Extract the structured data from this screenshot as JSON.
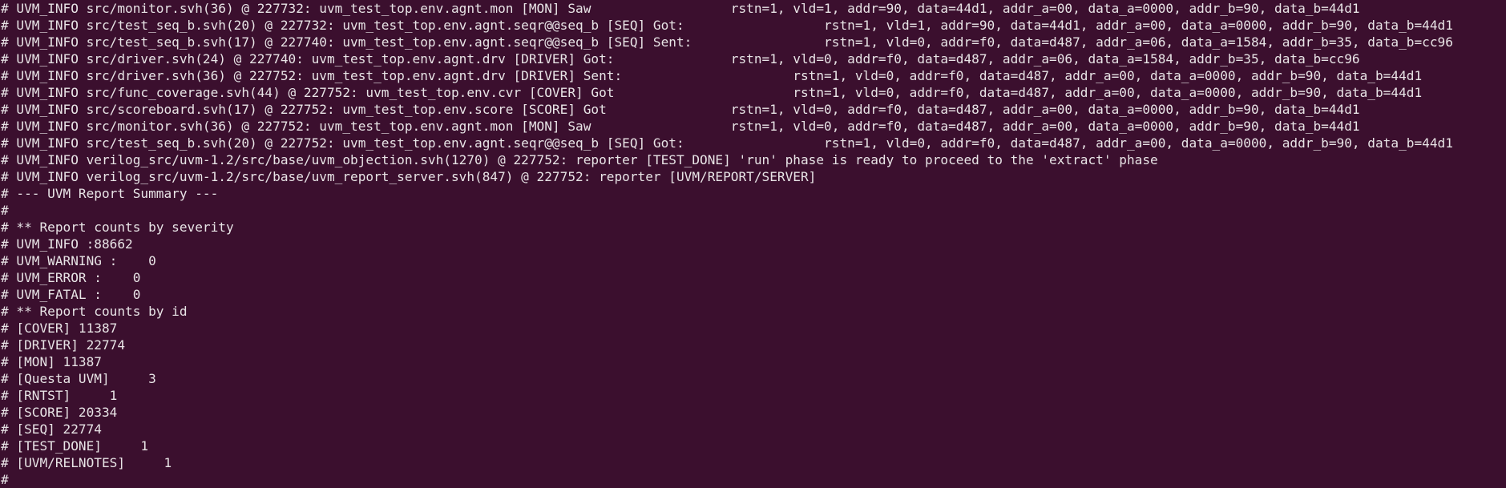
{
  "terminal": {
    "lines": [
      "# UVM_INFO src/monitor.svh(36) @ 227732: uvm_test_top.env.agnt.mon [MON] Saw                  rstn=1, vld=1, addr=90, data=44d1, addr_a=00, data_a=0000, addr_b=90, data_b=44d1",
      "# UVM_INFO src/test_seq_b.svh(20) @ 227732: uvm_test_top.env.agnt.seqr@@seq_b [SEQ] Got:                  rstn=1, vld=1, addr=90, data=44d1, addr_a=00, data_a=0000, addr_b=90, data_b=44d1",
      "# UVM_INFO src/test_seq_b.svh(17) @ 227740: uvm_test_top.env.agnt.seqr@@seq_b [SEQ] Sent:                 rstn=1, vld=0, addr=f0, data=d487, addr_a=06, data_a=1584, addr_b=35, data_b=cc96",
      "# UVM_INFO src/driver.svh(24) @ 227740: uvm_test_top.env.agnt.drv [DRIVER] Got:               rstn=1, vld=0, addr=f0, data=d487, addr_a=06, data_a=1584, addr_b=35, data_b=cc96",
      "# UVM_INFO src/driver.svh(36) @ 227752: uvm_test_top.env.agnt.drv [DRIVER] Sent:                      rstn=1, vld=0, addr=f0, data=d487, addr_a=00, data_a=0000, addr_b=90, data_b=44d1",
      "# UVM_INFO src/func_coverage.svh(44) @ 227752: uvm_test_top.env.cvr [COVER] Got                       rstn=1, vld=0, addr=f0, data=d487, addr_a=00, data_a=0000, addr_b=90, data_b=44d1",
      "# UVM_INFO src/scoreboard.svh(17) @ 227752: uvm_test_top.env.score [SCORE] Got                rstn=1, vld=0, addr=f0, data=d487, addr_a=00, data_a=0000, addr_b=90, data_b=44d1",
      "# UVM_INFO src/monitor.svh(36) @ 227752: uvm_test_top.env.agnt.mon [MON] Saw                  rstn=1, vld=0, addr=f0, data=d487, addr_a=00, data_a=0000, addr_b=90, data_b=44d1",
      "# UVM_INFO src/test_seq_b.svh(20) @ 227752: uvm_test_top.env.agnt.seqr@@seq_b [SEQ] Got:                  rstn=1, vld=0, addr=f0, data=d487, addr_a=00, data_a=0000, addr_b=90, data_b=44d1",
      "# UVM_INFO verilog_src/uvm-1.2/src/base/uvm_objection.svh(1270) @ 227752: reporter [TEST_DONE] 'run' phase is ready to proceed to the 'extract' phase",
      "# UVM_INFO verilog_src/uvm-1.2/src/base/uvm_report_server.svh(847) @ 227752: reporter [UVM/REPORT/SERVER]",
      "# --- UVM Report Summary ---",
      "#",
      "# ** Report counts by severity",
      "# UVM_INFO :88662",
      "# UVM_WARNING :    0",
      "# UVM_ERROR :    0",
      "# UVM_FATAL :    0",
      "# ** Report counts by id",
      "# [COVER] 11387",
      "# [DRIVER] 22774",
      "# [MON] 11387",
      "# [Questa UVM]     3",
      "# [RNTST]     1",
      "# [SCORE] 20334",
      "# [SEQ] 22774",
      "# [TEST_DONE]     1",
      "# [UVM/RELNOTES]     1",
      "#"
    ]
  },
  "colors": {
    "background": "#3b0f2e",
    "foreground": "#e8e4e6"
  }
}
